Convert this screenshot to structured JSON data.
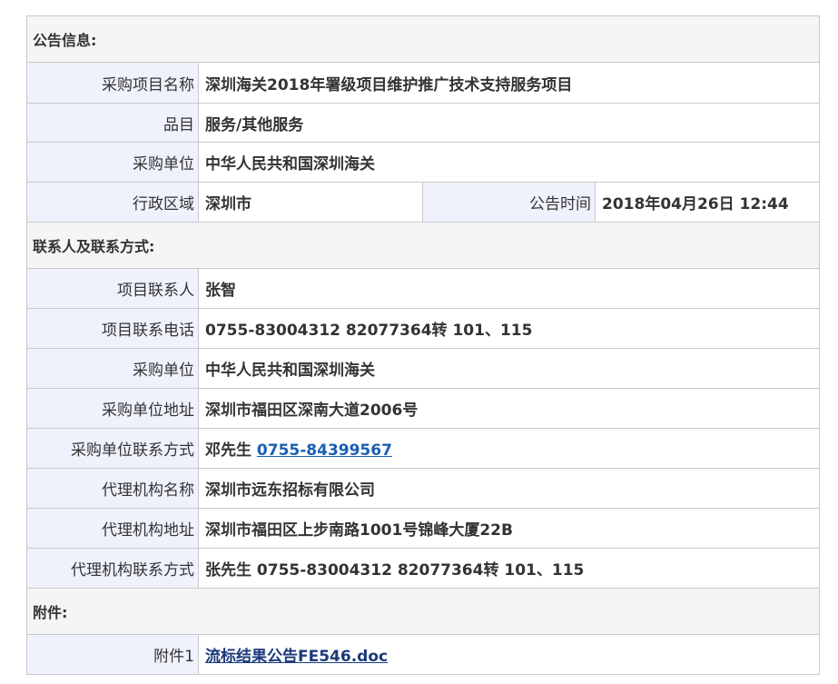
{
  "announcement": {
    "section_title": "公告信息:",
    "project_name_label": "采购项目名称",
    "project_name": "深圳海关2018年署级项目维护推广技术支持服务项目",
    "category_label": "品目",
    "category": "服务/其他服务",
    "purchaser_label": "采购单位",
    "purchaser": "中华人民共和国深圳海关",
    "region_label": "行政区域",
    "region": "深圳市",
    "time_label": "公告时间",
    "time": "2018年04月26日 12:44"
  },
  "contact": {
    "section_title": "联系人及联系方式:",
    "project_contact_label": "项目联系人",
    "project_contact": "张智",
    "project_phone_label": "项目联系电话",
    "project_phone": "0755-83004312 82077364转 101、115",
    "purchaser_label": "采购单位",
    "purchaser": "中华人民共和国深圳海关",
    "purchaser_address_label": "采购单位地址",
    "purchaser_address": "深圳市福田区深南大道2006号",
    "purchaser_contact_label": "采购单位联系方式",
    "purchaser_contact_name": "邓先生",
    "purchaser_contact_phone": "0755-84399567",
    "agency_name_label": "代理机构名称",
    "agency_name": "深圳市远东招标有限公司",
    "agency_address_label": "代理机构地址",
    "agency_address": "深圳市福田区上步南路1001号锦峰大厦22B",
    "agency_contact_label": "代理机构联系方式",
    "agency_contact": "张先生 0755-83004312 82077364转 101、115"
  },
  "attachments": {
    "section_title": "附件:",
    "attachment1_label": "附件1",
    "attachment1_file": "流标结果公告FE546.doc"
  }
}
